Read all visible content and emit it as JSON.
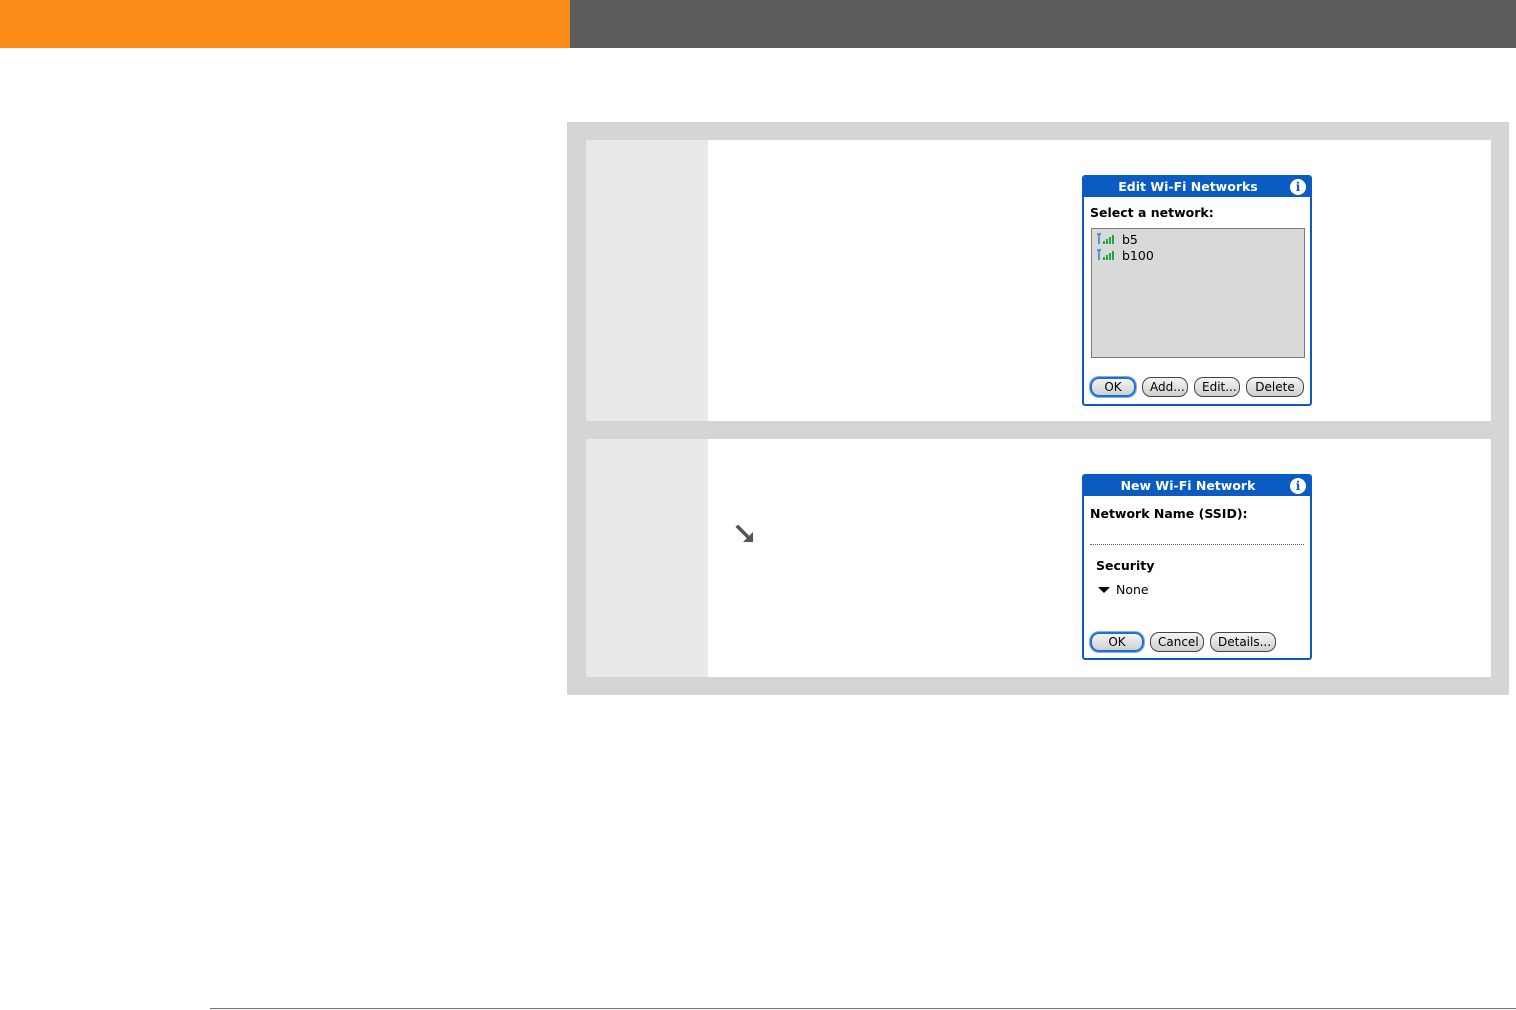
{
  "header": {
    "left_color": "#fb8a17",
    "right_color": "#5c5c5c"
  },
  "steps": [
    {
      "dialog": {
        "title": "Edit Wi-Fi Networks",
        "info_icon": "info-icon",
        "prompt": "Select a network:",
        "networks": [
          {
            "name": "b5",
            "icon": "wifi-signal-icon"
          },
          {
            "name": "b100",
            "icon": "wifi-signal-icon"
          }
        ],
        "buttons": {
          "ok": "OK",
          "add": "Add...",
          "edit": "Edit...",
          "delete": "Delete"
        }
      }
    },
    {
      "hint_icon": "arrow-down-right-icon",
      "dialog": {
        "title": "New Wi-Fi Network",
        "info_icon": "info-icon",
        "ssid_label": "Network Name (SSID):",
        "ssid_value": "",
        "security_label": "Security",
        "security_value": "None",
        "buttons": {
          "ok": "OK",
          "cancel": "Cancel",
          "details": "Details..."
        }
      }
    }
  ],
  "colors": {
    "dialog_blue": "#0b5cc2",
    "panel_gray": "#d5d5d5",
    "step_cell": "#e9e9e9"
  }
}
